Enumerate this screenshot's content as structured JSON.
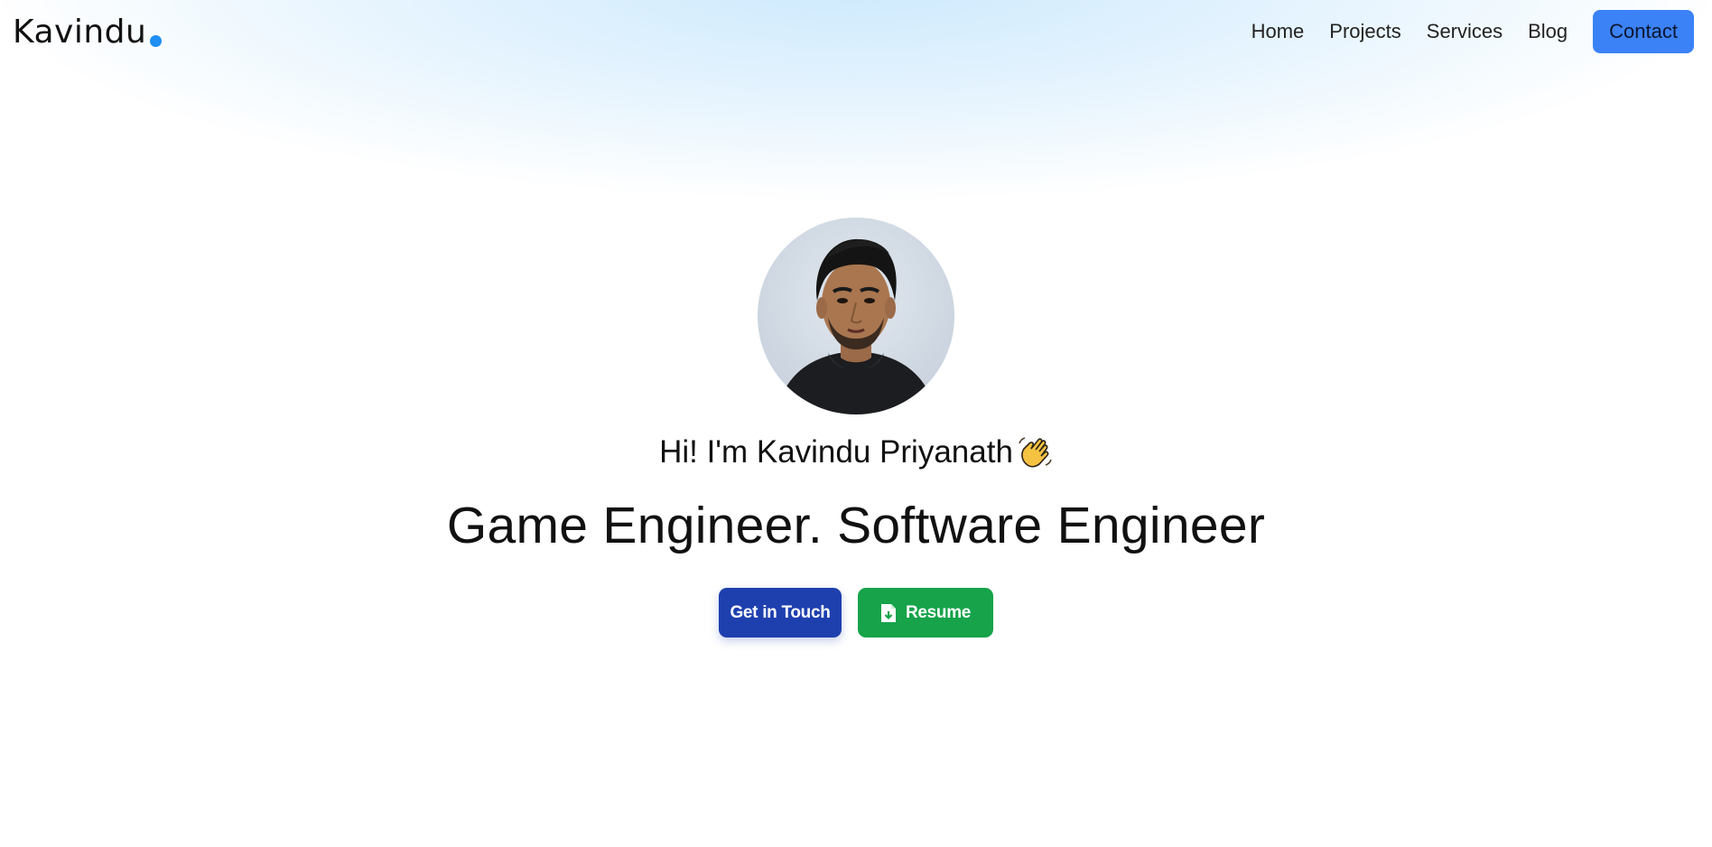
{
  "header": {
    "logo_text": "Kavindu",
    "nav": [
      {
        "label": "Home"
      },
      {
        "label": "Projects"
      },
      {
        "label": "Services"
      },
      {
        "label": "Blog"
      }
    ],
    "contact_label": "Contact"
  },
  "hero": {
    "avatar_icon": "profile-photo",
    "greeting": "Hi! I'm Kavindu Priyanath",
    "greeting_icon": "waving-hand-icon",
    "tagline": "Game Engineer. Software Engineer",
    "buttons": {
      "get_in_touch": "Get in Touch",
      "resume": "Resume",
      "resume_icon": "file-download-icon"
    }
  },
  "colors": {
    "accent_blue": "#3b82f6",
    "primary_navy": "#1e40af",
    "success_green": "#16a34a",
    "logo_dot": "#1f8ff2",
    "glow": "#d6edfd"
  }
}
